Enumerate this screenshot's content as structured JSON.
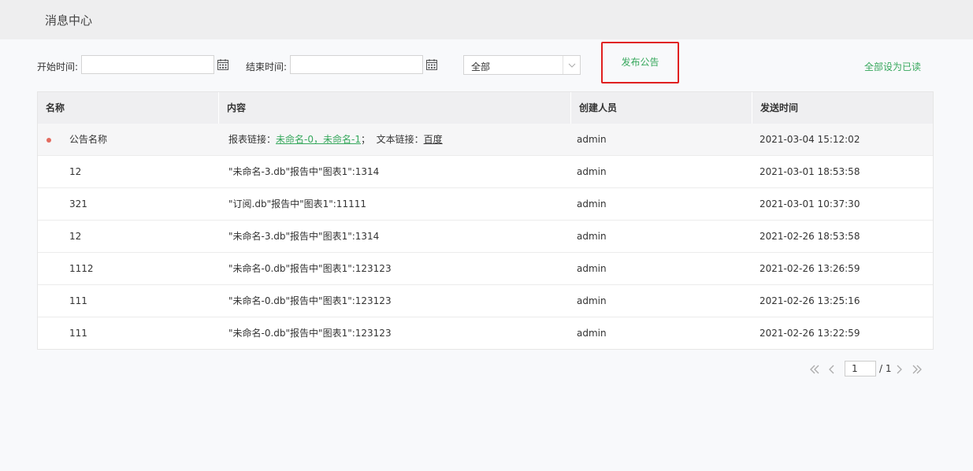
{
  "header": {
    "title": "消息中心"
  },
  "filters": {
    "start_label": "开始时间:",
    "start_value": "",
    "end_label": "结束时间:",
    "end_value": "",
    "status_select": "全部"
  },
  "actions": {
    "publish": "发布公告",
    "mark_all_read": "全部设为已读"
  },
  "table": {
    "columns": [
      "名称",
      "内容",
      "创建人员",
      "发送时间"
    ],
    "rows": [
      {
        "name": "公告名称",
        "unread": true,
        "content_prefix": "报表链接：",
        "content_link1": "未命名-0",
        "content_comma": "，",
        "content_link2": "未命名-1",
        "content_sep": "；  文本链接：",
        "content_link3": "百度",
        "creator": "admin",
        "time": "2021-03-04 15:12:02"
      },
      {
        "name": "12",
        "content": "\"未命名-3.db\"报告中\"图表1\":1314",
        "creator": "admin",
        "time": "2021-03-01 18:53:58"
      },
      {
        "name": "321",
        "content": "\"订阅.db\"报告中\"图表1\":11111",
        "creator": "admin",
        "time": "2021-03-01 10:37:30"
      },
      {
        "name": "12",
        "content": "\"未命名-3.db\"报告中\"图表1\":1314",
        "creator": "admin",
        "time": "2021-02-26 18:53:58"
      },
      {
        "name": "1112",
        "content": "\"未命名-0.db\"报告中\"图表1\":123123",
        "creator": "admin",
        "time": "2021-02-26 13:26:59"
      },
      {
        "name": "111",
        "content": "\"未命名-0.db\"报告中\"图表1\":123123",
        "creator": "admin",
        "time": "2021-02-26 13:25:16"
      },
      {
        "name": "111",
        "content": "\"未命名-0.db\"报告中\"图表1\":123123",
        "creator": "admin",
        "time": "2021-02-26 13:22:59"
      }
    ]
  },
  "pagination": {
    "current": "1",
    "total": "/ 1"
  },
  "colors": {
    "accent_green": "#37a85d",
    "highlight_red": "#e02020",
    "unread_dot": "#e36b5f"
  }
}
